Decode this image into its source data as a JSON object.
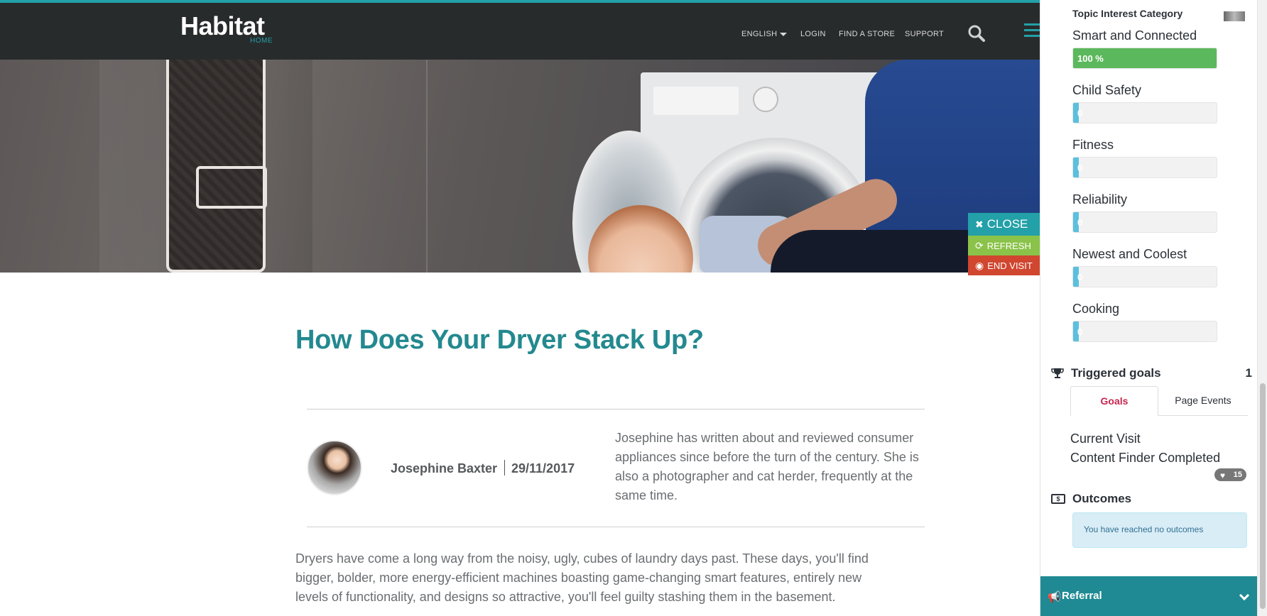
{
  "header": {
    "logo": "Habitat",
    "logo_sub": "HOME",
    "nav": {
      "language": "ENGLISH",
      "login": "LOGIN",
      "find_store": "FIND A STORE",
      "support": "SUPPORT"
    }
  },
  "visit_controls": {
    "close": "CLOSE",
    "refresh": "REFRESH",
    "end_visit": "END VISIT"
  },
  "article": {
    "title": "How Does Your Dryer Stack Up?",
    "author": "Josephine Baxter",
    "date": "29/11/2017",
    "bio": "Josephine has written about and reviewed consumer appliances since before the turn of the century. She is also a photographer and cat herder, frequently at the same time.",
    "body": "Dryers have come a long way from the noisy, ugly, cubes of laundry days past. These days, you'll find bigger, bolder, more energy-efficient machines boasting game-changing smart features, entirely new levels of functionality, and designs so attractive, you'll feel guilty stashing them in the basement."
  },
  "sidebar": {
    "category_title": "Topic Interest Category",
    "topics": [
      {
        "label": "Smart and Connected",
        "value_text": "100 %",
        "fraction": 1.0
      },
      {
        "label": "Child Safety",
        "value_text": "0",
        "fraction": 0.0
      },
      {
        "label": "Fitness",
        "value_text": "0",
        "fraction": 0.0
      },
      {
        "label": "Reliability",
        "value_text": "0",
        "fraction": 0.0
      },
      {
        "label": "Newest and Coolest",
        "value_text": "0",
        "fraction": 0.0
      },
      {
        "label": "Cooking",
        "value_text": "0",
        "fraction": 0.0
      }
    ],
    "goals": {
      "title": "Triggered goals",
      "count": "1",
      "tabs": [
        "Goals",
        "Page Events"
      ],
      "items": [
        "Current Visit",
        "Content Finder Completed"
      ],
      "badge": "15"
    },
    "outcomes": {
      "title": "Outcomes",
      "message": "You have reached no outcomes"
    },
    "referral": {
      "title": "Referral"
    }
  },
  "colors": {
    "accent": "#23a0a8",
    "header_bg": "#282b2c",
    "title": "#23898f",
    "success": "#5cb85c",
    "info": "#5bc0de",
    "refresh": "#8bc34a",
    "end_visit": "#d0462f",
    "active_tab": "#c7254e"
  }
}
